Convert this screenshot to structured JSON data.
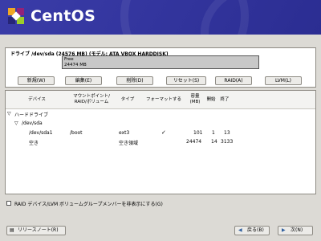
{
  "branding": {
    "logo_text": "CentOS"
  },
  "drive": {
    "title": "ドライブ /dev/sda (24576 MB) (モデル: ATA VBOX HARDDISK)",
    "free_label": "Free",
    "free_size": "24474 MB"
  },
  "toolbar": {
    "new": "新規(W)",
    "edit": "編集(E)",
    "delete": "削除(D)",
    "reset": "リセット(S)",
    "raid": "RAID(A)",
    "lvm": "LVM(L)"
  },
  "table": {
    "headers": [
      "デバイス",
      "マウントポイント/\nRAID/ボリューム",
      "タイプ",
      "フォーマットする",
      "容量\n(MB)",
      "開始",
      "終了"
    ],
    "tree": {
      "root": "ハードドライブ",
      "disk": "/dev/sda",
      "rows": [
        {
          "device": "/dev/sda1",
          "mount": "/boot",
          "type": "ext3",
          "format": "✓",
          "size": "101",
          "start": "1",
          "end": "13"
        },
        {
          "device": "空き",
          "mount": "",
          "type": "空き領域",
          "format": "",
          "size": "24474",
          "start": "14",
          "end": "3133"
        }
      ]
    }
  },
  "hide_raid_lvm_label": "RAID デバイス/LVM ボリュームグループメンバーを非表示にする(G)",
  "footer": {
    "release_notes": "リリースノート(R)",
    "back": "戻る(B)",
    "next": "次(N)"
  }
}
